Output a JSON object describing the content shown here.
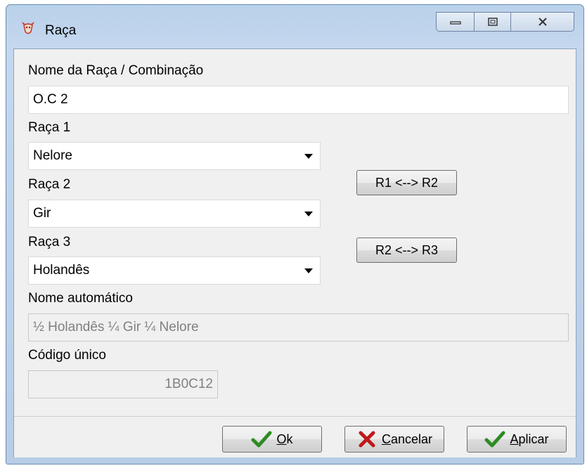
{
  "window": {
    "title": "Raça"
  },
  "form": {
    "name_label": "Nome da Raça / Combinação",
    "name_value": "O.C 2",
    "raca1_label": "Raça 1",
    "raca1_value": "Nelore",
    "raca2_label": "Raça 2",
    "raca2_value": "Gir",
    "raca3_label": "Raça 3",
    "raca3_value": "Holandês",
    "swap12_label": "R1 <--> R2",
    "swap23_label": "R2 <--> R3",
    "auto_name_label": "Nome automático",
    "auto_name_value": "½ Holandês  ¼ Gir  ¼ Nelore",
    "code_label": "Código único",
    "code_value": "1B0C12"
  },
  "buttons": {
    "ok_first": "O",
    "ok_rest": "k",
    "cancel_first": "C",
    "cancel_rest": "ancelar",
    "apply_first": "A",
    "apply_rest": "plicar"
  }
}
